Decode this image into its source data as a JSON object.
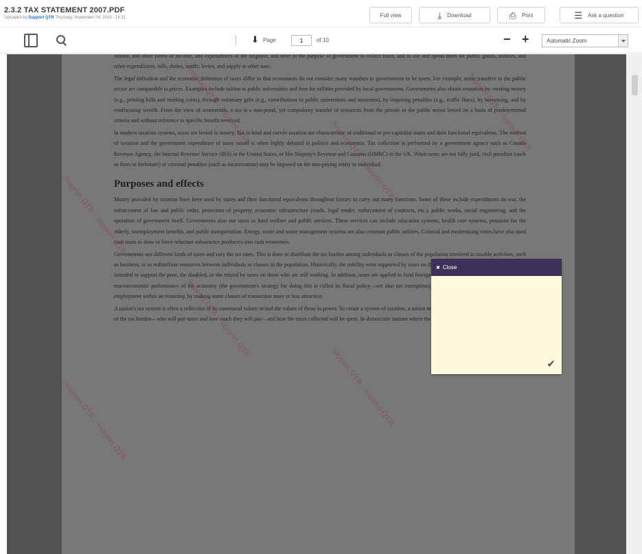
{
  "header": {
    "title": "2.3.2 TAX STATEMENT 2007.PDF",
    "meta_prefix": "Uploaded by",
    "meta_author": "Support QTR",
    "meta_date": "Thursday, September 04, 2019 - 14:31",
    "buttons": {
      "full_view": "Full view",
      "download": "Download",
      "print": "Print",
      "ask": "Ask a question"
    }
  },
  "toolbar": {
    "page_label": "Page",
    "page_value": "1",
    "page_total": "of 10",
    "zoom_out": "−",
    "zoom_in": "+",
    "zoom_value": "Automatic Zoom"
  },
  "document": {
    "para0": "rations, and other forms of income, and expenditures of the taxpayer, and refer to the purpose of government to collect taxes, and to use and spend them for public goods, utilities, and other expenditures, tolls, duties, tariffs, levies, and supply in other uses.",
    "para1": "The legal definition and the economic definition of taxes differ in that economists do not consider many transfers to governments to be taxes. For example, some transfers to the public sector are comparable to prices. Examples include tuition at public universities and fees for utilities provided by local governments. Governments also obtain resources by creating money (e.g., printing bills and minting coins), through voluntary gifts (e.g., contributions to public universities and museums), by imposing penalties (e.g., traffic fines), by borrowing, and by confiscating wealth. From the view of economists, a tax is a non-penal, yet compulsory transfer of resources from the private to the public sector levied on a basis of predetermined criteria and without reference to specific benefit received.",
    "para2": "In modern taxation systems, taxes are levied in money; but in-kind and corvée taxation are characteristic of traditional or pre-capitalist states and their functional equivalents. The method of taxation and the government expenditure of taxes raised is often highly debated in politics and economics. Tax collection is performed by a government agency such as Canada Revenue Agency, the Internal Revenue Service (IRS) in the United States, or Her Majesty's Revenue and Customs (HMRC) in the UK. When taxes are not fully paid, civil penalties (such as fines or forfeiture) or criminal penalties (such as incarceration) may be imposed on the non-paying entity or individual.",
    "heading": "Purposes and effects",
    "para3": "Money provided by taxation have been used by states and their functional equivalents throughout history to carry out many functions. Some of these include expenditures on war, the enforcement of law and public order, protection of property, economic infrastructure (roads, legal tender, enforcement of contracts, etc.), public works, social engineering, and the operation of government itself. Governments also use taxes to fund welfare and public services. These services can include education systems, health care systems, pensions for the elderly, unemployment benefits, and public transportation. Energy, water and waste management systems are also common public utilities. Colonial and modernizing states have also used cash taxes to draw or force reluctant subsistence producers into cash economies.",
    "para4": "Governments use different kinds of taxes and vary the tax rates. This is done to distribute the tax burden among individuals or classes of the population involved in taxable activities, such as business, or to redistribute resources between individuals or classes in the population. Historically, the nobility were supported by taxes on the poor; modern social security systems are intended to support the poor, the disabled, or the retired by taxes on those who are still working. In addition, taxes are applied to fund foreign aid and military ventures, to influence the macroeconomic performance of the economy (the government's strategy for doing this is called its fiscal policy—see also tax exemption), or to modify patterns of consumption or employment within an economy, by making some classes of transaction more or less attractive.",
    "para5": "A nation's tax system is often a reflection of its communal values or/and the values of those in power. To create a system of taxation, a nation must make choices regarding the distribution of the tax burden—who will pay taxes and how much they will pay—and how the taxes collected will be spent. In democratic nations where the public elects"
  },
  "watermark": "Support QTR - Support QTR",
  "note": {
    "header": "Close"
  },
  "icons": {
    "download": "download-icon",
    "print": "print-icon",
    "ask": "chat-icon",
    "sidebar": "sidebar-toggle-icon",
    "search": "search-icon",
    "page_up": "page-arrow-icon",
    "note_check": "check-icon"
  }
}
